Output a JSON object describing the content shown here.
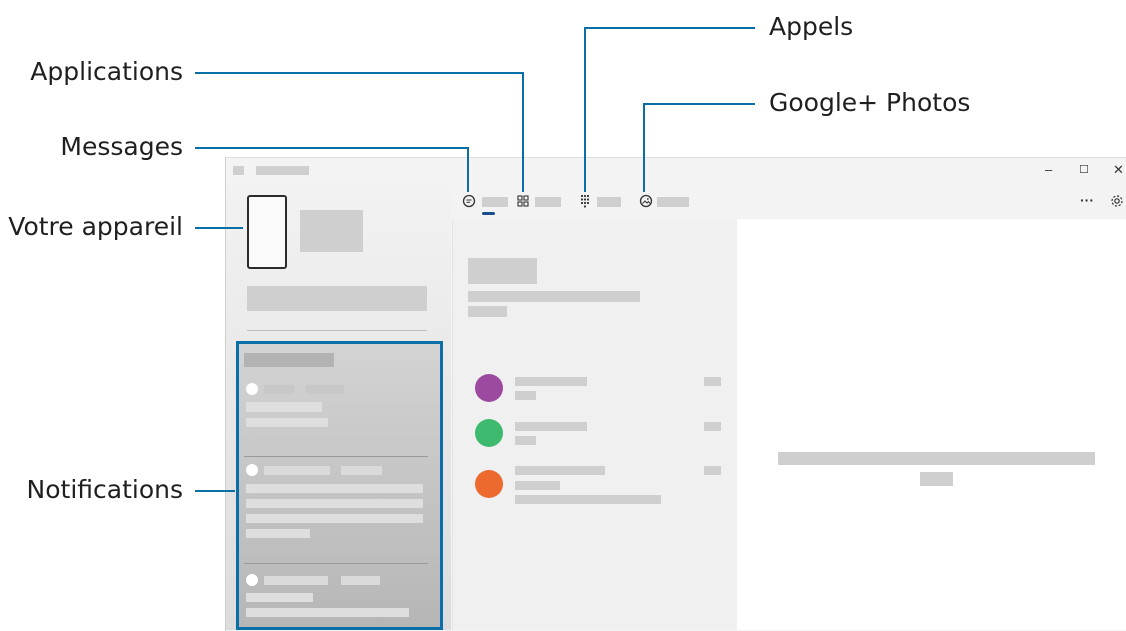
{
  "callouts": {
    "applications": "Applications",
    "messages": "Messages",
    "votre_appareil": "Votre appareil",
    "notifications": "Notifications",
    "appels": "Appels",
    "google_photos": "Google+ Photos"
  },
  "window_controls": {
    "minimize": "–",
    "maximize": "☐",
    "close": "✕",
    "more": "···"
  },
  "icons": {
    "messages_tab": "chat-bubble",
    "apps_tab": "apps-grid",
    "calls_tab": "dialpad",
    "photos_tab": "image",
    "settings": "gear"
  },
  "colors": {
    "callout_line": "#0a6fa6",
    "contact_1": "#9b4aa0",
    "contact_2": "#3dba6e",
    "contact_3": "#ec6a2e",
    "tab_indicator": "#1a4f8f"
  }
}
